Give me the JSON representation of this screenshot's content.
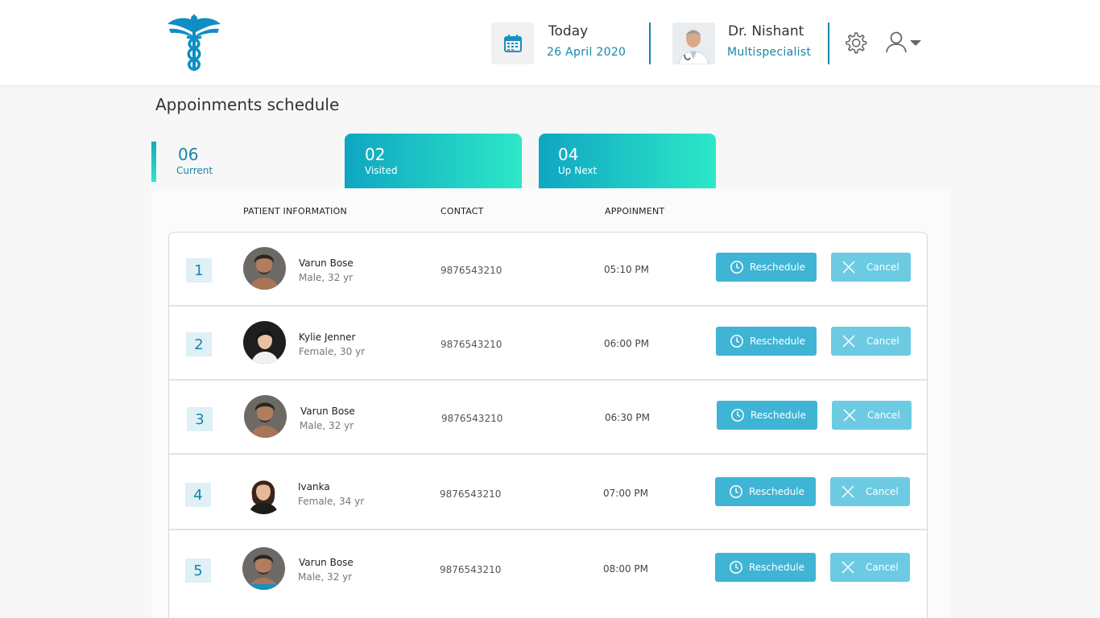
{
  "header": {
    "today_label": "Today",
    "today_date": "26 April 2020",
    "doctor_name": "Dr. Nishant",
    "doctor_specialty": "Multispecialist",
    "icons": [
      "caduceus-logo",
      "calendar-icon",
      "doctor-avatar",
      "gear-icon",
      "user-icon",
      "chevron-down-icon"
    ]
  },
  "page": {
    "title": "Appoinments schedule"
  },
  "tabs": [
    {
      "count": "06",
      "label": "Current"
    },
    {
      "count": "02",
      "label": "Visited"
    },
    {
      "count": "04",
      "label": "Up Next"
    }
  ],
  "table": {
    "headers": [
      "PATIENT INFORMATION",
      "CONTACT",
      "APPOINMENT"
    ],
    "rows": [
      {
        "index": "1",
        "name": "Varun Bose",
        "meta": "Male, 32 yr",
        "contact": "9876543210",
        "time": "05:10 PM",
        "reschedule": "Reschedule",
        "cancel": "Cancel"
      },
      {
        "index": "2",
        "name": "Kylie Jenner",
        "meta": "Female, 30 yr",
        "contact": "9876543210",
        "time": "06:00 PM",
        "reschedule": "Reschedule",
        "cancel": "Cancel"
      },
      {
        "index": "3",
        "name": "Varun Bose",
        "meta": "Male, 32 yr",
        "contact": "9876543210",
        "time": "06:30 PM",
        "reschedule": "Reschedule",
        "cancel": "Cancel"
      },
      {
        "index": "4",
        "name": "Ivanka",
        "meta": "Female, 34 yr",
        "contact": "9876543210",
        "time": "07:00 PM",
        "reschedule": "Reschedule",
        "cancel": "Cancel"
      },
      {
        "index": "5",
        "name": "Varun Bose",
        "meta": "Male, 32 yr",
        "contact": "9876543210",
        "time": "08:00 PM",
        "reschedule": "Reschedule",
        "cancel": "Cancel"
      }
    ]
  },
  "colors": {
    "accent": "#1587a8",
    "button_reschedule": "#3fb4d4",
    "button_cancel": "#6ccbe3"
  }
}
